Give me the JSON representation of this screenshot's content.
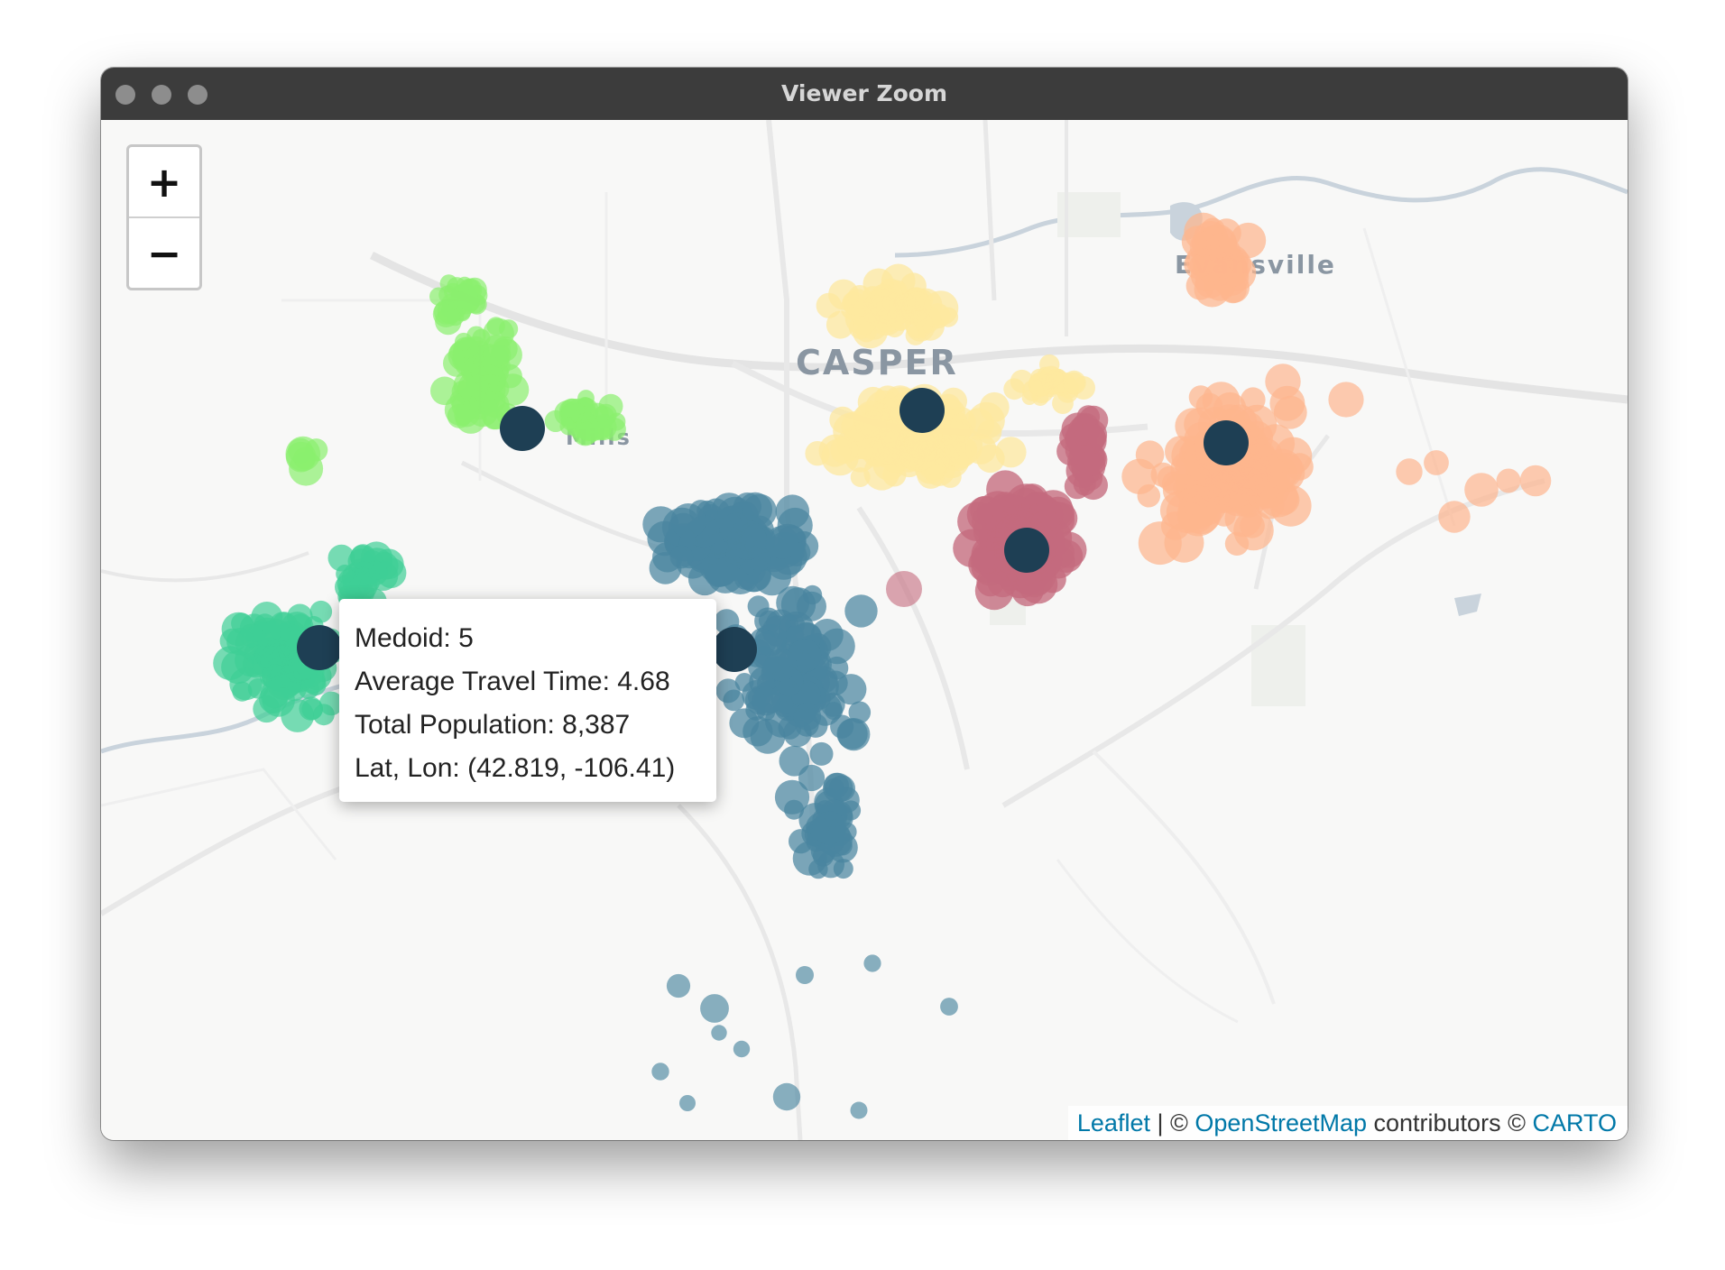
{
  "window": {
    "title": "Viewer Zoom"
  },
  "zoom": {
    "in_label": "+",
    "out_label": "−"
  },
  "map_labels": {
    "city": "CASPER",
    "town_right": "Evansville",
    "town_left": "Mills"
  },
  "popup": {
    "lines": [
      "Medoid: 5",
      "Average Travel Time: 4.68",
      "Total Population: 8,387",
      "Lat, Lon: (42.819, -106.41)"
    ]
  },
  "attribution": {
    "leaflet": "Leaflet",
    "sep": " | © ",
    "osm": "OpenStreetMap",
    "contributors": " contributors © ",
    "carto": "CARTO"
  },
  "colors": {
    "medoid": "#1e3f54",
    "cluster_green": "#8af06e",
    "cluster_teal": "#3fce96",
    "cluster_blue": "#4a85a0",
    "cluster_yellow": "#fde89f",
    "cluster_red": "#c46a7d",
    "cluster_orange": "#feb58e",
    "water": "#c9d3dc",
    "road": "#e4e4e4"
  }
}
